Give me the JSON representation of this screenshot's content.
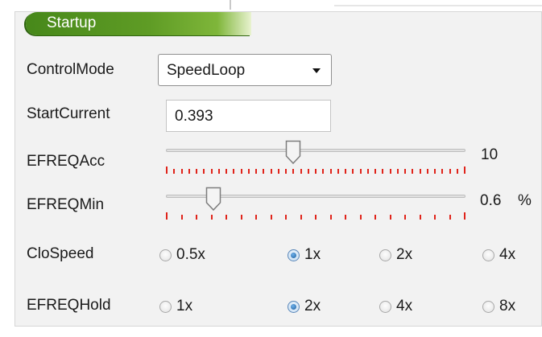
{
  "section": {
    "title": "Startup"
  },
  "control_mode": {
    "label": "ControlMode",
    "value": "SpeedLoop"
  },
  "start_current": {
    "label": "StartCurrent",
    "value": "0.393"
  },
  "efreq_acc": {
    "label": "EFREQAcc",
    "value": "10",
    "level": 0.42
  },
  "efreq_min": {
    "label": "EFREQMin",
    "value": "0.6",
    "unit": "%",
    "level": 0.14
  },
  "clo_speed": {
    "label": "CloSpeed",
    "options": [
      "0.5x",
      "1x",
      "2x",
      "4x"
    ],
    "selected": "1x"
  },
  "efreq_hold": {
    "label": "EFREQHold",
    "options": [
      "1x",
      "2x",
      "4x",
      "8x"
    ],
    "selected": "2x"
  },
  "colors": {
    "header_green": "#5f9c25",
    "tick_red": "#e0241b",
    "radio_blue": "#1f5f9f",
    "panel_bg": "#f2f2f2"
  }
}
